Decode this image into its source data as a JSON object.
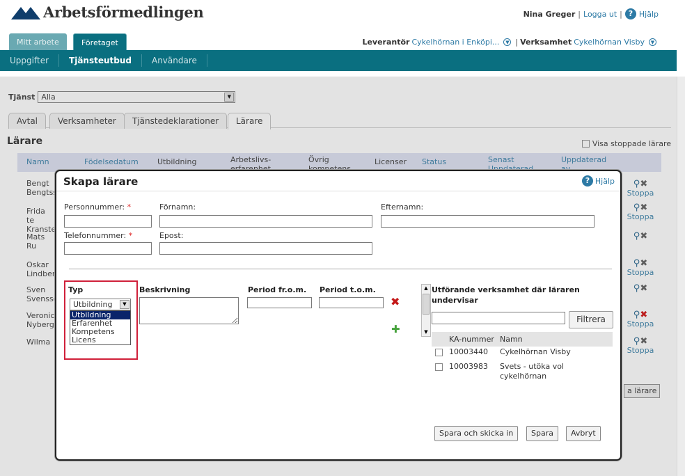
{
  "header": {
    "logo_text": "Arbetsförmedlingen",
    "user_name": "Nina Greger",
    "logout_label": "Logga ut",
    "help_label": "Hjälp",
    "separator": "|"
  },
  "top_tabs": [
    {
      "label": "Mitt arbete",
      "active": false
    },
    {
      "label": "Företaget",
      "active": true
    }
  ],
  "context": {
    "leverantor_label": "Leverantör",
    "leverantor_value": "Cykelhörnan i Enköpi...",
    "verksamhet_label": "Verksamhet",
    "verksamhet_value": "Cykelhörnan Visby"
  },
  "subnav": [
    {
      "label": "Uppgifter",
      "active": false
    },
    {
      "label": "Tjänsteutbud",
      "active": true
    },
    {
      "label": "Användare",
      "active": false
    }
  ],
  "filter": {
    "label": "Tjänst",
    "value": "Alla"
  },
  "page_tabs": [
    {
      "label": "Avtal",
      "active": false
    },
    {
      "label": "Verksamheter",
      "active": false
    },
    {
      "label": "Tjänstedeklarationer",
      "active": false
    },
    {
      "label": "Lärare",
      "active": true
    }
  ],
  "section": {
    "title": "Lärare",
    "show_stopped_label": "Visa stoppade lärare"
  },
  "table": {
    "columns": [
      "Namn",
      "Födelsedatum",
      "Utbildning",
      "Arbetslivs- erfarenhet",
      "Övrig kompetens",
      "Licenser",
      "Status",
      "Senast Uppdaterad",
      "Uppdaterad av"
    ],
    "rows": [
      {
        "name": "Bengt Bengtsson",
        "action": "Stoppa",
        "icons": [
          "search-icon",
          "delete-icon"
        ]
      },
      {
        "name": "Frida te Kranste",
        "action": "Stoppa",
        "icons": [
          "search-icon",
          "delete-icon"
        ]
      },
      {
        "name": "Mats Ru",
        "action": "",
        "icons": [
          "search-icon",
          "delete-icon"
        ]
      },
      {
        "name": "Oskar Lindberg",
        "action": "Stoppa",
        "icons": [
          "search-icon",
          "delete-icon"
        ]
      },
      {
        "name": "Sven Svensson",
        "action": "",
        "icons": [
          "search-icon",
          "delete-icon"
        ]
      },
      {
        "name": "Veronica Nyberg",
        "action": "Stoppa",
        "icons": [
          "search-icon",
          "delete-icon-red"
        ]
      },
      {
        "name": "Wilma",
        "action": "Stoppa",
        "icons": [
          "search-icon",
          "delete-icon"
        ]
      }
    ],
    "add_button_label": "a lärare"
  },
  "dialog": {
    "title": "Skapa lärare",
    "help_label": "Hjälp",
    "fields": {
      "personnummer": {
        "label": "Personnummer:",
        "required": true,
        "value": ""
      },
      "fornamn": {
        "label": "Förnamn:",
        "value": ""
      },
      "efternamn": {
        "label": "Efternamn:",
        "value": ""
      },
      "telefonnummer": {
        "label": "Telefonnummer:",
        "required": true,
        "value": ""
      },
      "epost": {
        "label": "Epost:",
        "value": ""
      }
    },
    "required_mark": "*",
    "columns": {
      "typ": "Typ",
      "beskrivning": "Beskrivning",
      "period_from": "Period fr.o.m.",
      "period_tom": "Period t.o.m."
    },
    "typ_selected": "Utbildning",
    "typ_options": [
      "Utbildning",
      "Erfarenhet",
      "Kompetens",
      "Licens"
    ],
    "utforande_heading": "Utförande verksamhet där läraren undervisar",
    "filter_button": "Filtrera",
    "filter_value": "",
    "ka_columns": {
      "nummer": "KA-nummer",
      "namn": "Namn"
    },
    "ka_rows": [
      {
        "nummer": "10003440",
        "namn": "Cykelhörnan Visby",
        "checked": false
      },
      {
        "nummer": "10003983",
        "namn": "Svets - utöka vol cykelhörnan",
        "checked": false
      }
    ],
    "buttons": {
      "save_submit": "Spara och skicka in",
      "save": "Spara",
      "cancel": "Avbryt"
    }
  },
  "colors": {
    "nav_teal": "#0a6f80",
    "link_blue": "#2d7aa5",
    "required_red": "#d22222",
    "highlight_red": "#d0203a",
    "table_header": "#dcdff1"
  }
}
